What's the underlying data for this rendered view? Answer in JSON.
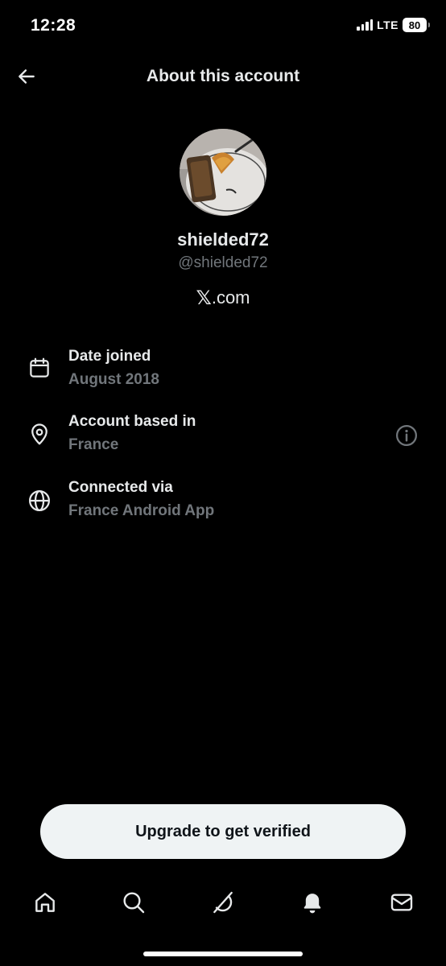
{
  "status_bar": {
    "time": "12:28",
    "network": "LTE",
    "battery": "80"
  },
  "header": {
    "title": "About this account",
    "back_icon": "arrow-left-icon"
  },
  "profile": {
    "display_name": "shielded72",
    "handle": "@shielded72",
    "site_x": "𝕏",
    "site_rest": ".com"
  },
  "info": [
    {
      "icon": "calendar-icon",
      "title": "Date joined",
      "value": "August 2018"
    },
    {
      "icon": "location-pin-icon",
      "title": "Account based in",
      "value": "France"
    },
    {
      "icon": "globe-icon",
      "title": "Connected via",
      "value": "France Android App"
    }
  ],
  "upgrade": {
    "label": "Upgrade to get verified"
  },
  "nav": [
    {
      "name": "home",
      "icon": "home-icon"
    },
    {
      "name": "search",
      "icon": "search-icon"
    },
    {
      "name": "grok",
      "icon": "grok-icon"
    },
    {
      "name": "notifications",
      "icon": "bell-icon"
    },
    {
      "name": "messages",
      "icon": "envelope-icon"
    }
  ],
  "colors": {
    "background": "#000000",
    "text_primary": "#e7e9ea",
    "text_secondary": "#71767b",
    "button_bg": "#eff3f4"
  }
}
